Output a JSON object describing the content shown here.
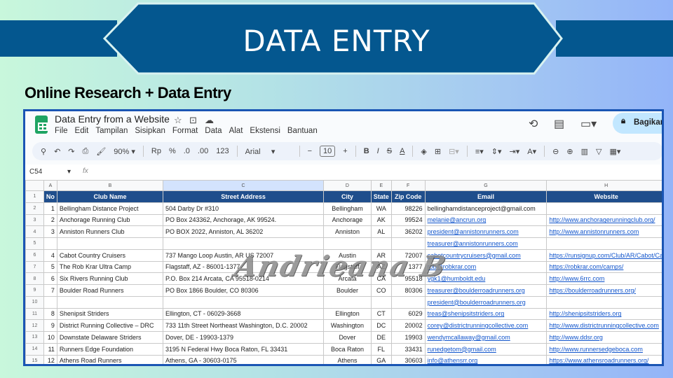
{
  "banner": {
    "title": "DATA ENTRY",
    "color": "#04578f"
  },
  "subtitle": "Online Research + Data Entry",
  "sheet": {
    "doc_title": "Data Entry from a Website",
    "menu": [
      "File",
      "Edit",
      "Tampilan",
      "Sisipkan",
      "Format",
      "Data",
      "Alat",
      "Ekstensi",
      "Bantuan"
    ],
    "share_label": "Bagikan",
    "toolbar": {
      "zoom": "90%",
      "currency": "Rp",
      "percent": "%",
      "dec_less": ".0",
      "dec_more": ".00",
      "format": "123",
      "font": "Arial",
      "font_size": "10",
      "bold": "B",
      "italic": "I",
      "strike": "S",
      "text_color": "A"
    },
    "cell_ref": "C54",
    "fx": "fx",
    "columns": [
      "A",
      "B",
      "C",
      "D",
      "E",
      "F",
      "G",
      "H"
    ],
    "headers": [
      "No",
      "Club Name",
      "Street Address",
      "City",
      "State",
      "Zip Code",
      "Email",
      "Website"
    ],
    "rows": [
      {
        "n": "2",
        "no": "1",
        "club": "Bellingham Distance Project",
        "addr": "504 Darby Dr #310",
        "city": "Bellingham",
        "state": "WA",
        "zip": "98226",
        "email": "bellinghamdistanceproject@gmail.com",
        "web": ""
      },
      {
        "n": "3",
        "no": "2",
        "club": "Anchorage Running Club",
        "addr": "PO Box 243362, Anchorage, AK  99524.",
        "city": "Anchorage",
        "state": "AK",
        "zip": "99524",
        "email": "melanie@ancrun.org",
        "web": "http://www.anchoragerunningclub.org/"
      },
      {
        "n": "4",
        "no": "3",
        "club": "Anniston Runners Club",
        "addr": "PO BOX 2022, Anniston, AL 36202",
        "city": "Anniston",
        "state": "AL",
        "zip": "36202",
        "email": "president@annistonrunners.com",
        "web": "http://www.annistonrunners.com"
      },
      {
        "n": "5",
        "no": "",
        "club": "",
        "addr": "",
        "city": "",
        "state": "",
        "zip": "",
        "email": "treasurer@annistonrunners.com",
        "web": ""
      },
      {
        "n": "6",
        "no": "4",
        "club": "Cabot Country Cruisers",
        "addr": "737 Mango Loop Austin, AR US 72007",
        "city": "Austin",
        "state": "AR",
        "zip": "72007",
        "email": "cabotcountrycruisers@gmail.com",
        "web": "https://runsignup.com/Club/AR/Cabot/Ca"
      },
      {
        "n": "7",
        "no": "5",
        "club": "The Rob Krar Ultra Camp",
        "addr": "Flagstaff, AZ - 86001-1377",
        "city": "Flagstaff",
        "state": "AZ",
        "zip": "1377",
        "email": "rob@robkrar.com",
        "web": "https://robkrar.com/camps/"
      },
      {
        "n": "8",
        "no": "6",
        "club": "Six Rivers Running Club",
        "addr": "P.O. Box 214 Arcata, CA 95518-0214",
        "city": "Arcata",
        "state": "CA",
        "zip": "95518",
        "email": "ygk1@humboldt.edu",
        "web": "http://www.6rrc.com"
      },
      {
        "n": "9",
        "no": "7",
        "club": "Boulder Road Runners",
        "addr": "PO Box 1866 Boulder, CO 80306",
        "city": "Boulder",
        "state": "CO",
        "zip": "80306",
        "email": "treasurer@boulderroadrunners.org",
        "web": "https://boulderroadrunners.org/"
      },
      {
        "n": "10",
        "no": "",
        "club": "",
        "addr": "",
        "city": "",
        "state": "",
        "zip": "",
        "email": "president@boulderroadrunners.org",
        "web": ""
      },
      {
        "n": "11",
        "no": "8",
        "club": "Shenipsit Striders",
        "addr": "Ellington, CT - 06029-3668",
        "city": "Ellington",
        "state": "CT",
        "zip": "6029",
        "email": "treas@shenipsitstriders.org",
        "web": "http://shenipsitstriders.org"
      },
      {
        "n": "12",
        "no": "9",
        "club": "District Running Collective – DRC",
        "addr": "733 11th Street Northeast Washington, D.C. 20002",
        "city": "Washington",
        "state": "DC",
        "zip": "20002",
        "email": "corey@districtrunningcollective.com",
        "web": "http://www.districtrunningcollective.com"
      },
      {
        "n": "13",
        "no": "10",
        "club": "Downstate Delaware Striders",
        "addr": "Dover, DE - 19903-1379",
        "city": "Dover",
        "state": "DE",
        "zip": "19903",
        "email": "wendymcallaway@gmail.com",
        "web": "http://www.ddsr.org"
      },
      {
        "n": "14",
        "no": "11",
        "club": "Runners Edge Foundation",
        "addr": "3195 N Federal Hwy Boca Raton, FL 33431",
        "city": "Boca Raton",
        "state": "FL",
        "zip": "33431",
        "email": "runedgetom@gmail.com",
        "web": "http://www.runnersedgeboca.com"
      },
      {
        "n": "15",
        "no": "12",
        "club": "Athens Road Runners",
        "addr": "Athens, GA - 30603-0175",
        "city": "Athens",
        "state": "GA",
        "zip": "30603",
        "email": "info@athensrr.org",
        "web": "https://www.athensroadrunners.org/"
      }
    ]
  },
  "watermark": "Andrieana B"
}
